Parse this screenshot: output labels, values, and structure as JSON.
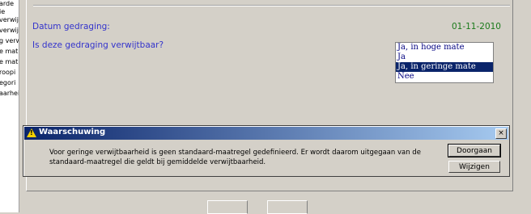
{
  "left_list": {
    "fragments": [
      "arde",
      "ie",
      "verwij",
      "verwijt",
      "g verwi",
      "e mat",
      "e mat",
      "roopi",
      "egori",
      "aarhei"
    ]
  },
  "form": {
    "date_label": "Datum gedraging:",
    "date_value": "01-11-2010",
    "question_label": "Is deze gedraging verwijtbaar?",
    "options": [
      "Ja, in hoge mate",
      "Ja",
      "Ja, in geringe mate",
      "Nee"
    ],
    "selected_option": "Ja, in geringe mate"
  },
  "dialog": {
    "title": "Waarschuwing",
    "message": "Voor geringe verwijtbaarheid is geen standaard-maatregel gedefinieerd. Er wordt daarom uitgegaan van de standaard-maatregel die geldt bij gemiddelde verwijtbaarheid.",
    "close_glyph": "×",
    "primary_button": "Doorgaan",
    "secondary_button": "Wijzigen"
  },
  "colors": {
    "label": "#3333cc",
    "date": "#1a7a1a",
    "selection": "#0a246a",
    "titlebar": "#0a246a"
  }
}
